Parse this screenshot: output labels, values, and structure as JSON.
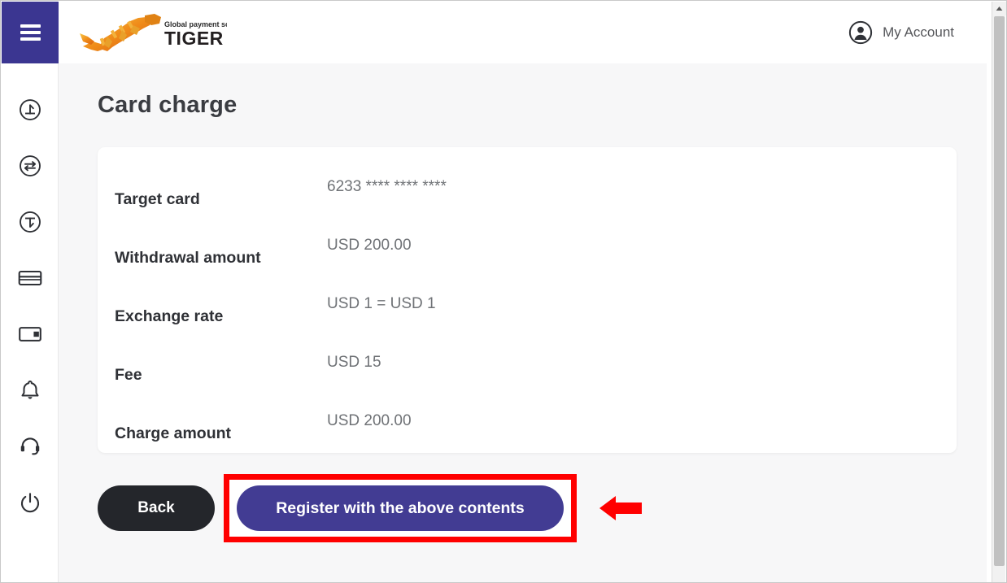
{
  "header": {
    "menu_icon": "hamburger-menu-icon",
    "logo": {
      "tagline": "Global payment solution",
      "brand": "TIGER PAY"
    },
    "account": {
      "icon": "user-circle-icon",
      "label": "My Account"
    }
  },
  "sidebar": {
    "items": [
      {
        "icon": "deposit-circle-arrow-up-icon",
        "name": "deposit"
      },
      {
        "icon": "exchange-circle-arrows-icon",
        "name": "exchange"
      },
      {
        "icon": "withdraw-circle-arrow-down-icon",
        "name": "withdraw"
      },
      {
        "icon": "credit-card-icon",
        "name": "card"
      },
      {
        "icon": "wallet-icon",
        "name": "wallet"
      },
      {
        "icon": "bell-icon",
        "name": "notifications"
      },
      {
        "icon": "headset-icon",
        "name": "support"
      },
      {
        "icon": "power-icon",
        "name": "logout"
      }
    ]
  },
  "main": {
    "title": "Card charge",
    "details": [
      {
        "label": "Target card",
        "value": "6233 **** **** ****"
      },
      {
        "label": "Withdrawal amount",
        "value": "USD 200.00"
      },
      {
        "label": "Exchange rate",
        "value": "USD 1 = USD 1"
      },
      {
        "label": "Fee",
        "value": "USD 15"
      },
      {
        "label": "Charge amount",
        "value": "USD 200.00"
      }
    ],
    "buttons": {
      "back": "Back",
      "register": "Register with the above contents"
    }
  },
  "annotation": {
    "highlight_color": "#ff0000",
    "arrow_icon": "left-arrow-annotation-icon"
  },
  "colors": {
    "brand_purple": "#3b3691",
    "button_purple": "#423c93",
    "dark_button": "#24262b",
    "page_background": "#f7f7f8",
    "logo_orange": "#f0a500"
  },
  "scrollbar": {
    "up_arrow_icon": "scroll-up-arrow-icon"
  }
}
